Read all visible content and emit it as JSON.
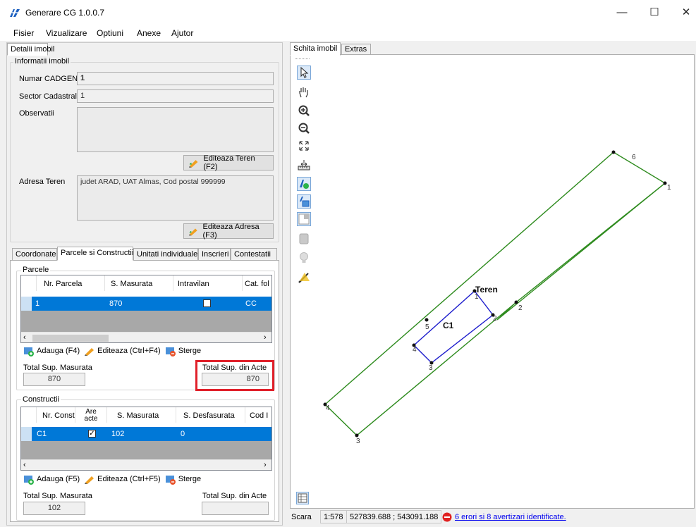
{
  "window": {
    "title": "Generare CG 1.0.0.7",
    "minimize": "—",
    "maximize": "☐",
    "close": "✕"
  },
  "menu": [
    "Fisier",
    "Vizualizare",
    "Optiuni",
    "Anexe",
    "Ajutor"
  ],
  "left_tab": "Detalii imobil",
  "info": {
    "group": "Informatii imobil",
    "numar_label": "Numar CADGEN",
    "numar_value": "1",
    "sector_label": "Sector Cadastral",
    "sector_value": "1",
    "obs_label": "Observatii",
    "obs_value": "",
    "edit_teren": "Editeaza Teren (F2)",
    "adresa_label": "Adresa Teren",
    "adresa_value": "judet ARAD, UAT Almas, Cod postal 999999",
    "edit_adresa": "Editeaza Adresa (F3)"
  },
  "bottom_tabs": [
    "Coordonate",
    "Parcele si Constructii",
    "Unitati individuale",
    "Inscrieri",
    "Contestatii"
  ],
  "parcele": {
    "group": "Parcele",
    "headers": [
      "Nr. Parcela",
      "S. Masurata",
      "Intravilan",
      "Cat. fol"
    ],
    "row": {
      "nr": "1",
      "s_masurata": "870",
      "cat": "CC"
    },
    "add": "Adauga (F4)",
    "edit": "Editeaza (Ctrl+F4)",
    "delete": "Sterge",
    "total_mas_label": "Total Sup. Masurata",
    "total_mas_value": "870",
    "total_acte_label": "Total Sup. din Acte",
    "total_acte_value": "870"
  },
  "constructii": {
    "group": "Constructii",
    "headers": [
      "Nr. Constr",
      "Are acte",
      "S. Masurata",
      "S. Desfasurata",
      "Cod I"
    ],
    "row": {
      "nr": "C1",
      "s_masurata": "102",
      "s_desf": "0"
    },
    "add": "Adauga (F5)",
    "edit": "Editeaza (Ctrl+F5)",
    "delete": "Sterge",
    "total_mas_label": "Total Sup. Masurata",
    "total_mas_value": "102",
    "total_acte_label": "Total Sup. din Acte",
    "total_acte_value": ""
  },
  "right_tabs": [
    "Schita imobil",
    "Extras"
  ],
  "tools": [
    "select-icon",
    "pan-icon",
    "zoom-in-icon",
    "zoom-out-icon",
    "zoom-extent-icon",
    "measure-icon",
    "layer-icon",
    "layer-move-icon",
    "layer-grid-icon",
    "print-icon",
    "bulb-icon",
    "warning-wand-icon"
  ],
  "sketch": {
    "teren_label": "Teren",
    "c1_label": "C1",
    "outer_points": [
      "1",
      "2",
      "3",
      "4",
      "5",
      "6"
    ],
    "inner_points": [
      "1",
      "2",
      "3",
      "4"
    ]
  },
  "status": {
    "scara_label": "Scara",
    "scale": "1:578",
    "coords": "527839.688 ; 543091.188",
    "errors": "6 erori si 8 avertizari identificate."
  },
  "colors": {
    "accent": "#0078d7",
    "parcel_line": "#2e8b1e",
    "building_line": "#1c1ccc",
    "highlight": "#e0202a"
  }
}
